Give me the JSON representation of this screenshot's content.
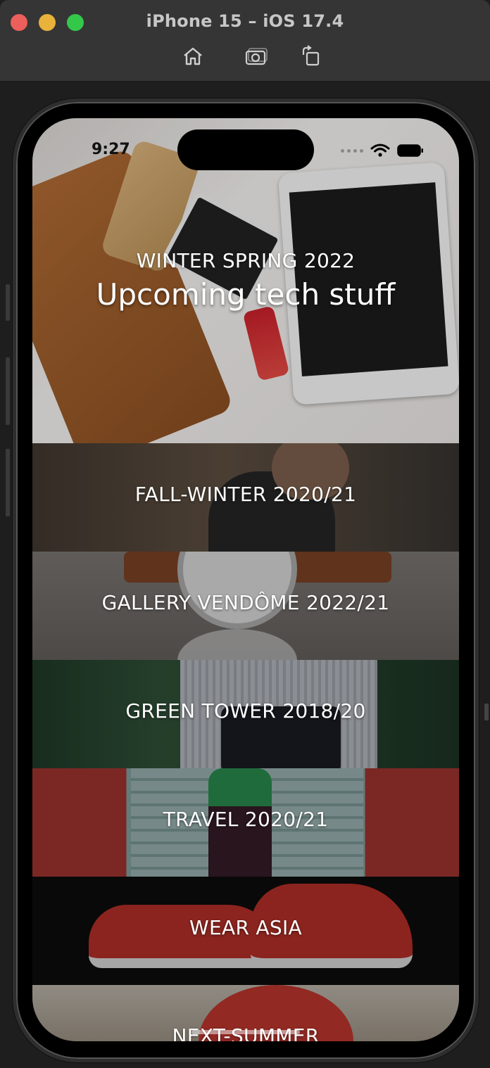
{
  "window": {
    "title": "iPhone 15 – iOS 17.4",
    "toolbar": [
      "home-icon",
      "screenshot-icon",
      "rotate-icon"
    ]
  },
  "status_bar": {
    "time": "9:27",
    "icons": [
      "cellular-dots-icon",
      "wifi-icon",
      "battery-icon"
    ]
  },
  "hero": {
    "subtitle": "WINTER SPRING 2022",
    "title": "Upcoming tech stuff"
  },
  "collections": [
    {
      "label": "FALL-WINTER 2020/21",
      "theme": "#5a4a3c"
    },
    {
      "label": "GALLERY VENDÔME 2022/21",
      "theme": "#6a5a4a"
    },
    {
      "label": "GREEN TOWER 2018/20",
      "theme": "#2f4a38"
    },
    {
      "label": "TRAVEL 2020/21",
      "theme": "#7f9a98"
    },
    {
      "label": "WEAR ASIA",
      "theme": "#111111"
    },
    {
      "label": "NEXT-SUMMER",
      "theme": "#b9b0a4"
    }
  ]
}
